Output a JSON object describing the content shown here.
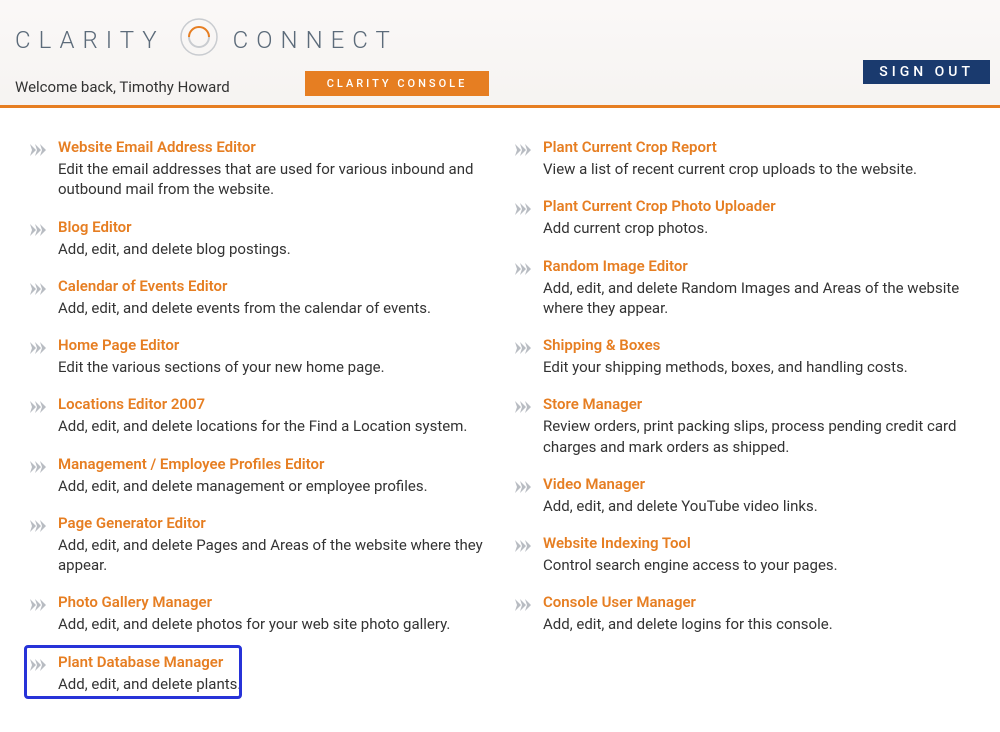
{
  "header": {
    "logo_left": "CLARITY",
    "logo_right": "CONNECT",
    "console_badge": "CLARITY CONSOLE",
    "welcome": "Welcome back, Timothy Howard",
    "signout": "SIGN OUT"
  },
  "colors": {
    "accent": "#e67e22",
    "signout_bg": "#1a3a6e",
    "highlight": "#2733d8"
  },
  "left_items": [
    {
      "title": "Website Email Address Editor",
      "desc": "Edit the email addresses that are used for various inbound and outbound mail from the website."
    },
    {
      "title": "Blog Editor",
      "desc": "Add, edit, and delete blog postings."
    },
    {
      "title": "Calendar of Events Editor",
      "desc": "Add, edit, and delete events from the calendar of events."
    },
    {
      "title": "Home Page Editor",
      "desc": "Edit the various sections of your new home page."
    },
    {
      "title": "Locations Editor 2007",
      "desc": "Add, edit, and delete locations for the Find a Location system."
    },
    {
      "title": "Management / Employee Profiles Editor",
      "desc": "Add, edit, and delete management or employee profiles."
    },
    {
      "title": "Page Generator Editor",
      "desc": "Add, edit, and delete Pages and Areas of the website where they appear."
    },
    {
      "title": "Photo Gallery Manager",
      "desc": "Add, edit, and delete photos for your web site photo gallery."
    },
    {
      "title": "Plant Database Manager",
      "desc": "Add, edit, and delete plants.",
      "highlighted": true
    }
  ],
  "right_items": [
    {
      "title": "Plant Current Crop Report",
      "desc": "View a list of recent current crop uploads to the website."
    },
    {
      "title": "Plant Current Crop Photo Uploader",
      "desc": "Add current crop photos."
    },
    {
      "title": "Random Image Editor",
      "desc": "Add, edit, and delete Random Images and Areas of the website where they appear."
    },
    {
      "title": "Shipping & Boxes",
      "desc": "Edit your shipping methods, boxes, and handling costs."
    },
    {
      "title": "Store Manager",
      "desc": "Review orders, print packing slips, process pending credit card charges and mark orders as shipped."
    },
    {
      "title": "Video Manager",
      "desc": "Add, edit, and delete YouTube video links."
    },
    {
      "title": "Website Indexing Tool",
      "desc": "Control search engine access to your pages."
    },
    {
      "title": "Console User Manager",
      "desc": "Add, edit, and delete logins for this console."
    }
  ]
}
